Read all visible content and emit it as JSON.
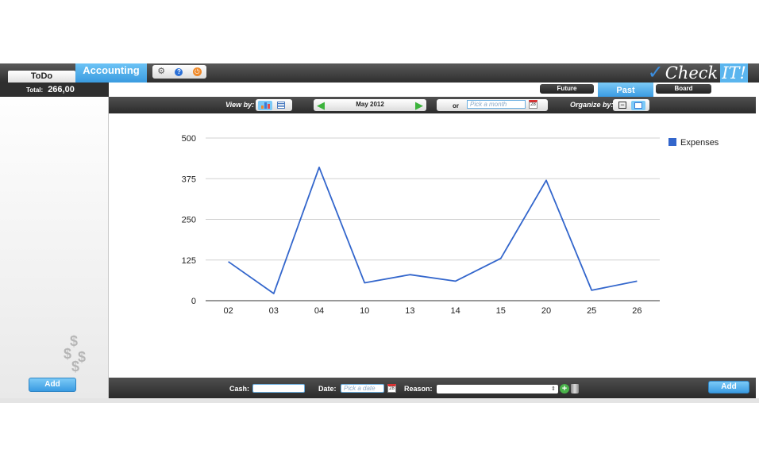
{
  "tabs": {
    "todo": "ToDo",
    "accounting": "Accounting"
  },
  "icons": {
    "settings": "gear-icon",
    "help": "help-icon",
    "power": "power-icon"
  },
  "logo": {
    "mark": "✓",
    "text": "Check",
    "suffix": "IT!"
  },
  "sidebar": {
    "total_label": "Total:",
    "total_value": "266,00",
    "add_label": "Add"
  },
  "view_tabs": [
    {
      "label": "Future",
      "active": false
    },
    {
      "label": "Past",
      "active": true
    },
    {
      "label": "Board",
      "active": false
    }
  ],
  "toolbar": {
    "view_by_label": "View by:",
    "current_month": "May 2012",
    "or_label": "or",
    "month_placeholder": "Pick a month",
    "calendar_day": "28",
    "organize_by_label": "Organize by:"
  },
  "form": {
    "cash_label": "Cash:",
    "date_label": "Date:",
    "date_placeholder": "Pick a date",
    "reason_label": "Reason:",
    "add_label": "Add"
  },
  "colors": {
    "accent": "#3a9be2",
    "line": "#3366cc",
    "dark_bar": "#2e2e2e"
  },
  "chart_data": {
    "type": "line",
    "categories": [
      "02",
      "03",
      "04",
      "10",
      "13",
      "14",
      "15",
      "20",
      "25",
      "26"
    ],
    "series": [
      {
        "name": "Expenses",
        "values": [
          120,
          22,
          410,
          55,
          80,
          60,
          130,
          370,
          32,
          60
        ]
      }
    ],
    "ylim": [
      0,
      500
    ],
    "yticks": [
      0,
      125,
      250,
      375,
      500
    ],
    "grid": true,
    "legend": "right"
  }
}
